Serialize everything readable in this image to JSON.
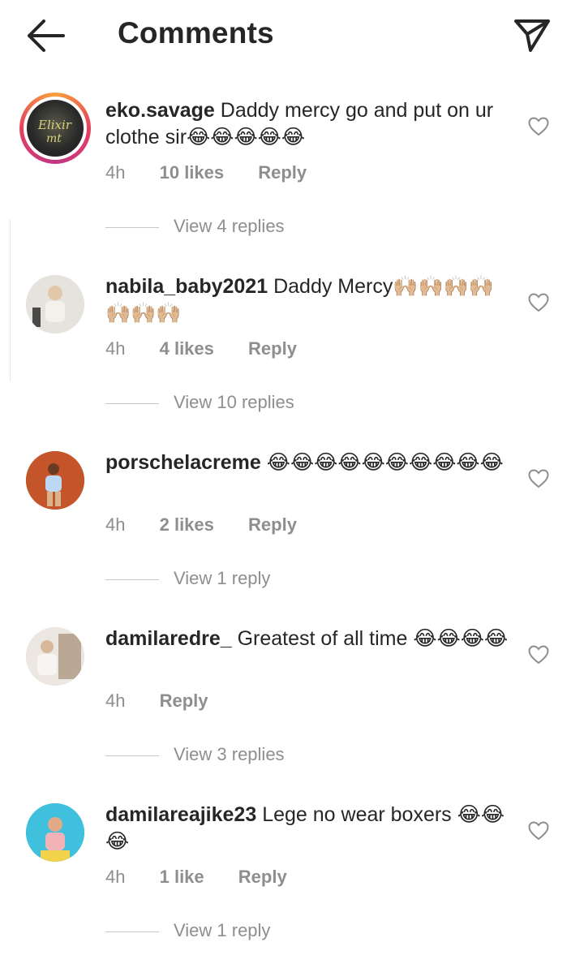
{
  "header": {
    "title": "Comments",
    "back_icon": "arrow-left-icon",
    "send_icon": "paper-plane-icon"
  },
  "comments": [
    {
      "username": "eko.savage",
      "text": "Daddy mercy go and put on ur clothe sir😂😂😂😂😂",
      "time": "4h",
      "likes": "10 likes",
      "reply": "Reply",
      "view_replies": "View 4 replies",
      "has_story": true,
      "avatar_color": "#2b2b2b"
    },
    {
      "username": "nabila_baby2021",
      "text": "Daddy Mercy🙌🏼🙌🏼🙌🏼🙌🏼🙌🏼🙌🏼🙌🏼",
      "time": "4h",
      "likes": "4 likes",
      "reply": "Reply",
      "view_replies": "View 10 replies",
      "has_story": false,
      "avatar_color": "#d9d6d0"
    },
    {
      "username": "porschelacreme",
      "text": "😂😂😂😂😂😂😂😂😂😂",
      "time": "4h",
      "likes": "2 likes",
      "reply": "Reply",
      "view_replies": "View 1 reply",
      "has_story": false,
      "avatar_color": "#c45a2a"
    },
    {
      "username": "damilaredre_",
      "text": "Greatest of all time 😂😂😂😂",
      "time": "4h",
      "likes": "",
      "reply": "Reply",
      "view_replies": "View 3 replies",
      "has_story": false,
      "avatar_color": "#d8cfc4"
    },
    {
      "username": "damilareajike23",
      "text": "Lege no wear boxers 😂😂😂",
      "time": "4h",
      "likes": "1 like",
      "reply": "Reply",
      "view_replies": "View 1 reply",
      "has_story": false,
      "avatar_color": "#34b8d6"
    }
  ]
}
